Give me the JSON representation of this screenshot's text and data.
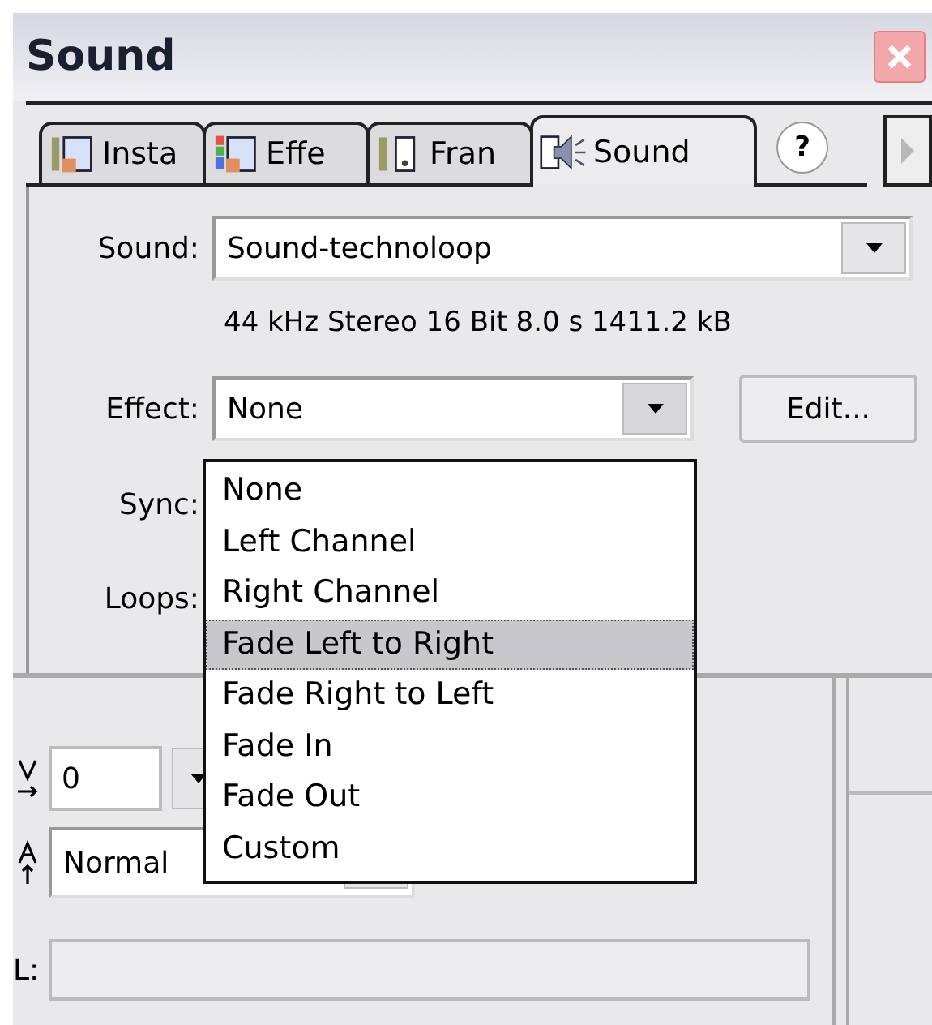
{
  "window": {
    "title": "Sound"
  },
  "tabs": [
    {
      "label": "Insta",
      "kind": "instance",
      "selected": false
    },
    {
      "label": "Effe",
      "kind": "effect",
      "selected": false
    },
    {
      "label": "Fran",
      "kind": "frame",
      "selected": false
    },
    {
      "label": "Sound",
      "kind": "sound",
      "selected": true
    }
  ],
  "help_button": {
    "label": "?"
  },
  "sound_field": {
    "label": "Sound:",
    "value": "Sound-technoloop"
  },
  "sound_info": "44 kHz Stereo 16 Bit 8.0 s 1411.2 kB",
  "effect_field": {
    "label": "Effect:",
    "value": "None",
    "expanded": true
  },
  "edit_button": {
    "label": "Edit..."
  },
  "sync_label": "Sync:",
  "loops_label": "Loops:",
  "effect_options": [
    {
      "label": "None",
      "selected": false
    },
    {
      "label": "Left Channel",
      "selected": false
    },
    {
      "label": "Right Channel",
      "selected": false
    },
    {
      "label": "Fade Left to Right",
      "selected": true
    },
    {
      "label": "Fade Right to Left",
      "selected": false
    },
    {
      "label": "Fade In",
      "selected": false
    },
    {
      "label": "Fade Out",
      "selected": false
    },
    {
      "label": "Custom",
      "selected": false
    }
  ],
  "lower_panel": {
    "v_field": {
      "value": "0"
    },
    "blend_field": {
      "value": "Normal"
    },
    "l_field": {
      "label": "L:",
      "disabled": true
    }
  }
}
